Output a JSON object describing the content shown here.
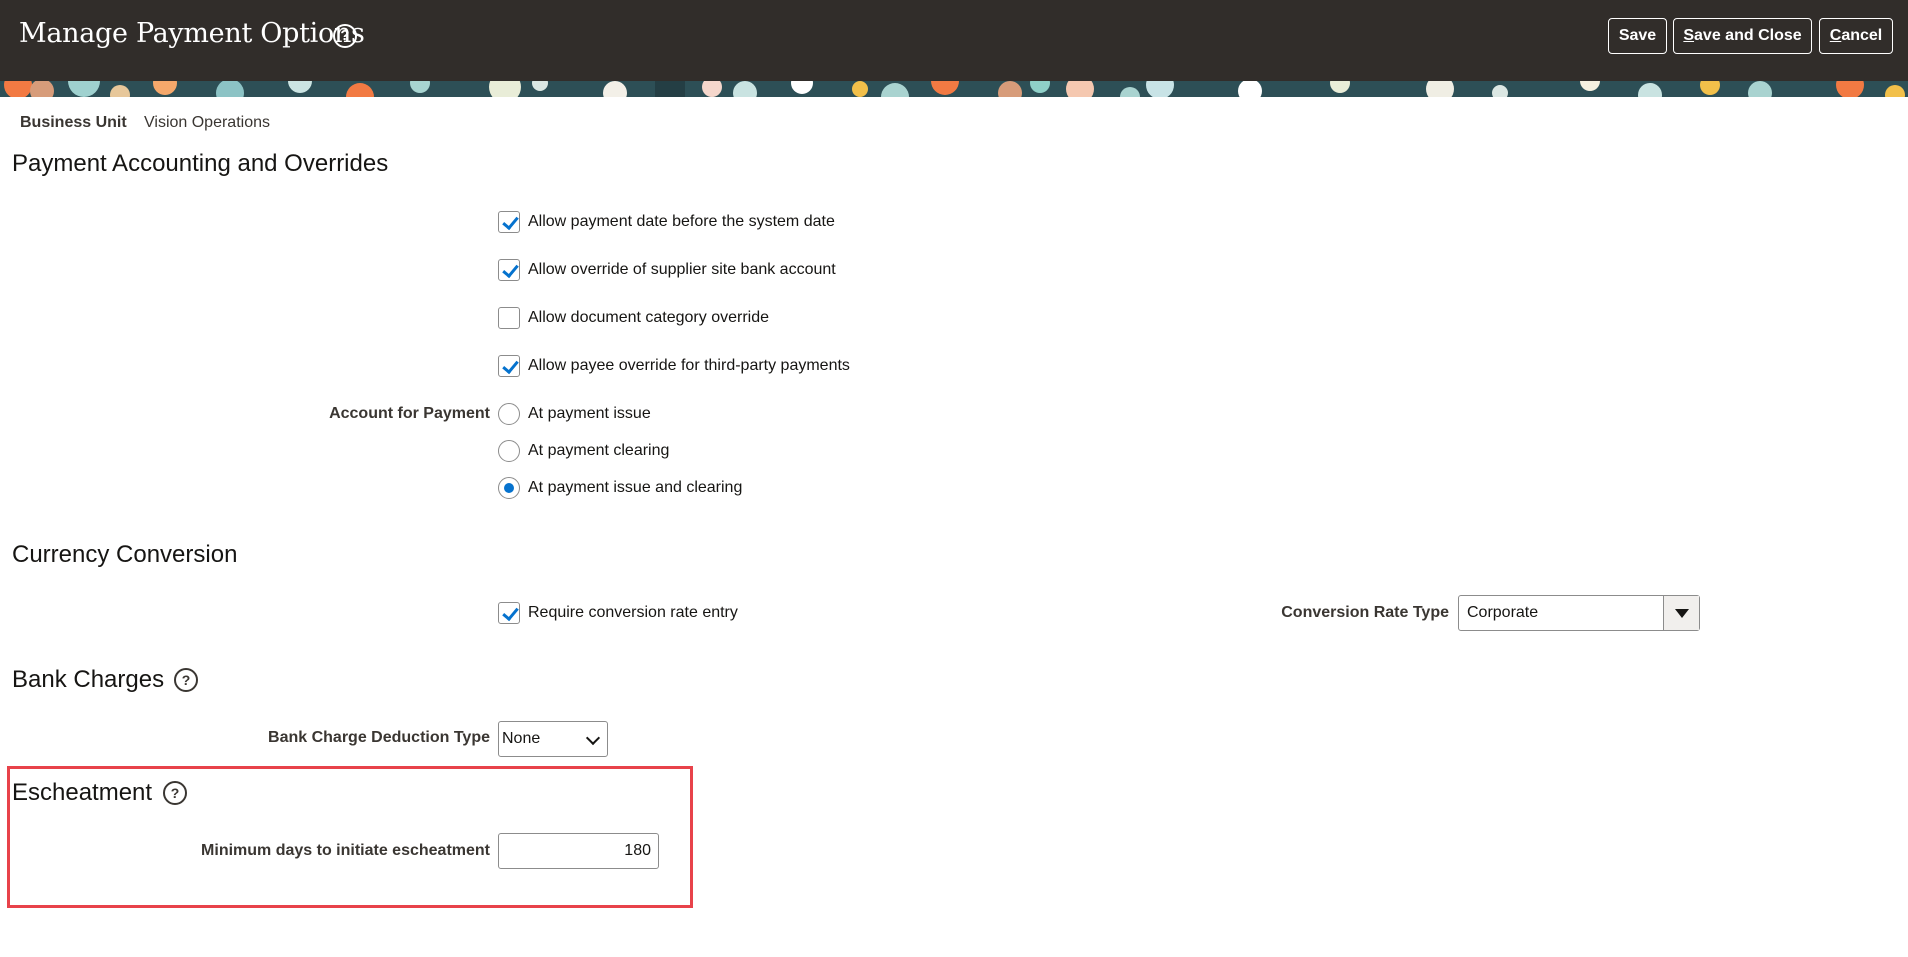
{
  "header": {
    "title": "Manage Payment Options",
    "help_glyph": "?",
    "buttons": {
      "save": "Save",
      "save_close_first": "S",
      "save_close_rest": "ave and Close",
      "cancel_first": "C",
      "cancel_rest": "ancel"
    }
  },
  "business_unit": {
    "label": "Business Unit",
    "value": "Vision Operations"
  },
  "payment_accounting": {
    "title": "Payment Accounting and Overrides",
    "options": [
      {
        "label": "Allow payment date before the system date",
        "checked": true
      },
      {
        "label": "Allow override of supplier site bank account",
        "checked": true
      },
      {
        "label": "Allow document category override",
        "checked": false
      },
      {
        "label": "Allow payee override for third-party payments",
        "checked": true
      }
    ],
    "account_for_payment": {
      "label": "Account for Payment",
      "choices": [
        "At payment issue",
        "At payment clearing",
        "At payment issue and clearing"
      ],
      "selected": "At payment issue and clearing"
    }
  },
  "currency_conversion": {
    "title": "Currency Conversion",
    "require_rate": {
      "label": "Require conversion rate entry",
      "checked": true
    },
    "rate_type": {
      "label": "Conversion Rate Type",
      "value": "Corporate"
    }
  },
  "bank_charges": {
    "title": "Bank Charges",
    "deduction_type": {
      "label": "Bank Charge Deduction Type",
      "value": "None"
    }
  },
  "escheatment": {
    "title": "Escheatment",
    "min_days": {
      "label": "Minimum days to initiate escheatment",
      "value": "180"
    }
  },
  "colors": {
    "header_bg": "#312d2a",
    "accent": "#0572ce",
    "highlight": "#e8424a"
  }
}
